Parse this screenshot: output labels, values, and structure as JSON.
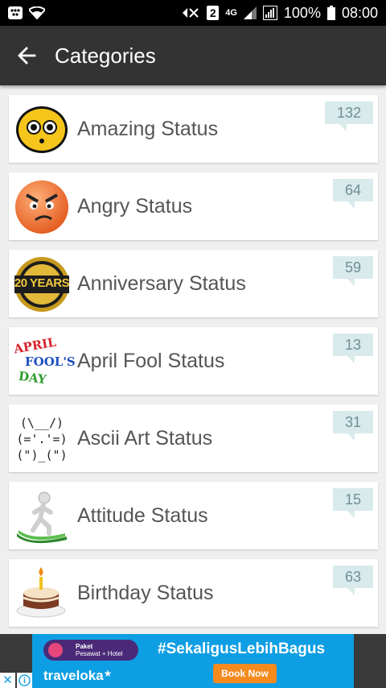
{
  "status_bar": {
    "battery": "100%",
    "time": "08:00",
    "sim_slot": "2",
    "network": "4G"
  },
  "app_bar": {
    "title": "Categories"
  },
  "categories": [
    {
      "label": "Amazing Status",
      "count": "132",
      "icon": "surprised-emoji-icon"
    },
    {
      "label": "Angry Status",
      "count": "64",
      "icon": "angry-emoji-icon"
    },
    {
      "label": "Anniversary Status",
      "count": "59",
      "icon": "anniversary-badge-icon"
    },
    {
      "label": "April Fool Status",
      "count": "13",
      "icon": "april-fools-day-icon"
    },
    {
      "label": "Ascii Art Status",
      "count": "31",
      "icon": "ascii-bunny-icon"
    },
    {
      "label": "Attitude Status",
      "count": "15",
      "icon": "running-figure-icon"
    },
    {
      "label": "Birthday Status",
      "count": "63",
      "icon": "birthday-cake-icon"
    }
  ],
  "icon_text": {
    "anniversary": "20 YEARS",
    "april": "APRIL",
    "fools": "FOOL'S",
    "day": "DAY",
    "ascii_1": "(\\__/)",
    "ascii_2": "(='.'=)",
    "ascii_3": "(\")_(\")"
  },
  "ad": {
    "promo_line1": "Paket",
    "promo_line2": "Pesawat + Hotel",
    "headline": "#SekaligusLebihBagus",
    "brand": "traveloka",
    "cta": "Book Now",
    "close": "✕"
  },
  "colors": {
    "app_bar": "#333333",
    "badge_bg": "#d9eaec",
    "badge_text": "#6e8f93",
    "ad_blue": "#0d9ee3",
    "ad_cta": "#f58a1f"
  }
}
